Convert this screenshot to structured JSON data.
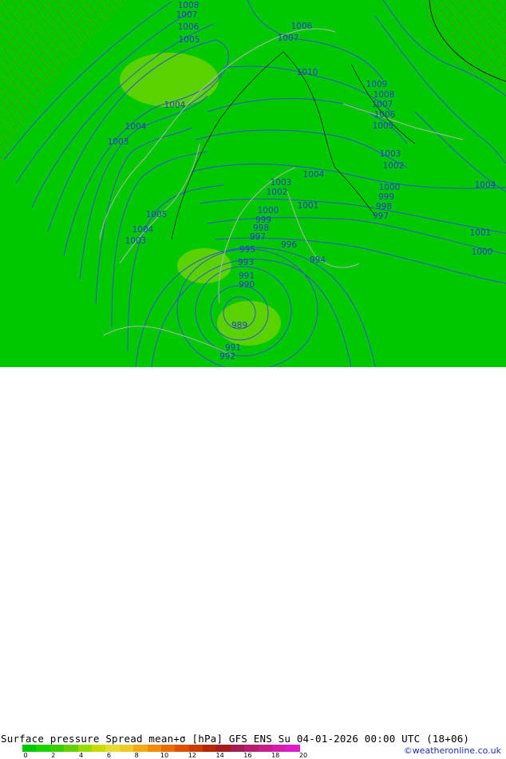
{
  "title": "Surface pressure Spread mean+σ [hPa] GFS ENS  Su 04-01-2026 00:00 UTC (18+06)",
  "credit": "©weatheronline.co.uk",
  "colorbar": {
    "ticks": [
      "0",
      "2",
      "4",
      "6",
      "8",
      "10",
      "12",
      "14",
      "16",
      "18",
      "20"
    ],
    "colors": [
      "#00c800",
      "#1ed200",
      "#3ccd00",
      "#64d200",
      "#96dc00",
      "#c8dc00",
      "#e6dc32",
      "#f0c828",
      "#f0aa14",
      "#f08c0a",
      "#e66e00",
      "#dc5000",
      "#c83c00",
      "#b42800",
      "#a01e1e",
      "#a01e50",
      "#b41e6e",
      "#c81e8c",
      "#d21eaa",
      "#dc1ec8"
    ]
  },
  "colors": {
    "background": "#00c800",
    "higher_spread": "#5ad200",
    "isobar": "#3a4fd6",
    "coast": "#b4b4b4",
    "border": "#1e1e1e",
    "hatch": "#d04020"
  },
  "isobar_labels": [
    {
      "text": "1008"
    },
    {
      "text": "1007"
    },
    {
      "text": "1006"
    },
    {
      "text": "1005"
    },
    {
      "text": "1004"
    },
    {
      "text": "1004"
    },
    {
      "text": "1003"
    },
    {
      "text": "1006"
    },
    {
      "text": "1007"
    },
    {
      "text": "1010"
    },
    {
      "text": "1009"
    },
    {
      "text": "1008"
    },
    {
      "text": "1007"
    },
    {
      "text": "1006"
    },
    {
      "text": "1005"
    },
    {
      "text": "1003"
    },
    {
      "text": "1002"
    },
    {
      "text": "1004"
    },
    {
      "text": "1003"
    },
    {
      "text": "1002"
    },
    {
      "text": "1001"
    },
    {
      "text": "1000"
    },
    {
      "text": "999"
    },
    {
      "text": "998"
    },
    {
      "text": "997"
    },
    {
      "text": "1000"
    },
    {
      "text": "999"
    },
    {
      "text": "998"
    },
    {
      "text": "997"
    },
    {
      "text": "996"
    },
    {
      "text": "995"
    },
    {
      "text": "993"
    },
    {
      "text": "994"
    },
    {
      "text": "991"
    },
    {
      "text": "990"
    },
    {
      "text": "989"
    },
    {
      "text": "991"
    },
    {
      "text": "992"
    },
    {
      "text": "1005"
    },
    {
      "text": "1004"
    },
    {
      "text": "1003"
    },
    {
      "text": "1004"
    },
    {
      "text": "1001"
    },
    {
      "text": "1000"
    }
  ]
}
